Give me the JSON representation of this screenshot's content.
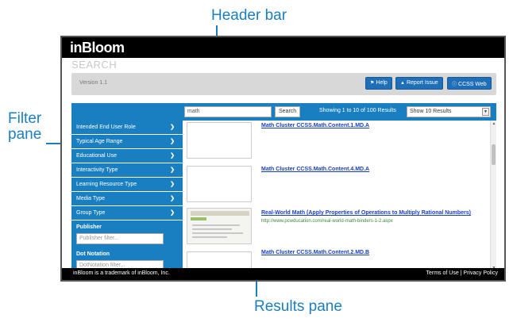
{
  "annotations": {
    "header_bar": "Header bar",
    "filter_pane_line1": "Filter",
    "filter_pane_line2": "pane",
    "results_pane": "Results pane"
  },
  "app": {
    "logo": "inBloom",
    "page_title": "SEARCH",
    "version": "Version 1.1"
  },
  "header": {
    "buttons": [
      {
        "icon": "flag-icon",
        "label": "Help"
      },
      {
        "icon": "warning-icon",
        "label": "Report Issue"
      },
      {
        "icon": "info-icon",
        "label": "CCSS Web"
      }
    ]
  },
  "search": {
    "query": "math",
    "button_label": "Search",
    "showing_text": "Showing 1 to 10 of 100 Results",
    "page_size": "Show 10 Results"
  },
  "filters": {
    "facets": [
      "Intended End User Role",
      "Typical Age Range",
      "Educational Use",
      "Interactivity Type",
      "Learning Resource Type",
      "Media Type",
      "Group Type"
    ],
    "publisher_label": "Publisher",
    "publisher_placeholder": "Publisher filter...",
    "dot_notation_label": "Dot Notation",
    "dot_notation_placeholder": "DotNotation filter..."
  },
  "results": [
    {
      "title": "Math Cluster CCSS.Math.Content.1.MD.A",
      "url": "",
      "thumb": "blank"
    },
    {
      "title": "Math Cluster CCSS.Math.Content.4.MD.A",
      "url": "",
      "thumb": "blank"
    },
    {
      "title": "Real-World Math (Apply Properties of Operations to Multiply Rational Numbers)",
      "url": "http://www.pcwducation.com/real-world-math-binders-1-2.aspx",
      "thumb": "screenshot"
    },
    {
      "title": "Math Cluster CCSS.Math.Content.2.MD.B",
      "url": "",
      "thumb": "blank"
    }
  ],
  "footer": {
    "trademark": "inBloom is a trademark of inBloom, Inc.",
    "links": "Terms of Use | Privacy Policy"
  },
  "colors": {
    "accent": "#1a7fc1",
    "button": "#1f6fb8",
    "link": "#1a3fbd",
    "url": "#3a8a3a",
    "bar": "#000000"
  }
}
